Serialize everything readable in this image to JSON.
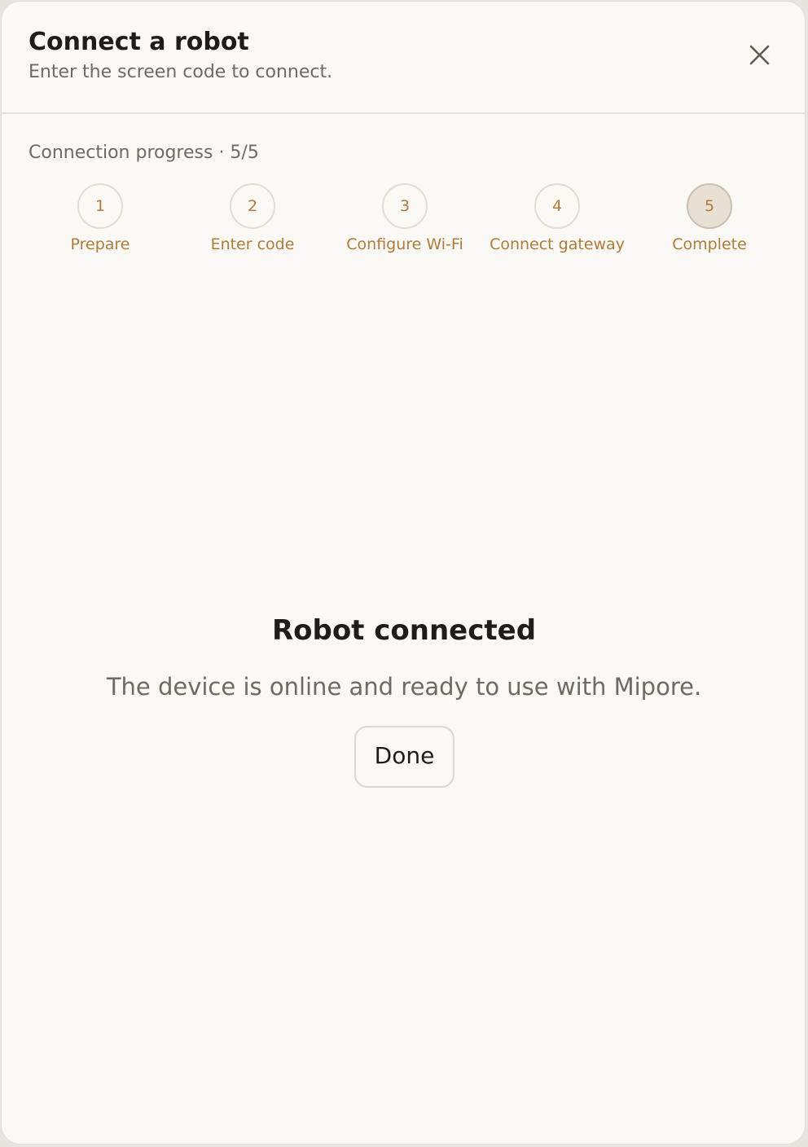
{
  "dialog": {
    "title": "Connect a robot",
    "subtitle": "Enter the screen code to connect.",
    "close_icon": "close-icon"
  },
  "progress": {
    "label": "Connection progress · 5/5",
    "current_step": 5,
    "total_steps": 5,
    "steps": [
      {
        "number": "1",
        "label": "Prepare"
      },
      {
        "number": "2",
        "label": "Enter code"
      },
      {
        "number": "3",
        "label": "Configure Wi-Fi"
      },
      {
        "number": "4",
        "label": "Connect gateway"
      },
      {
        "number": "5",
        "label": "Complete"
      }
    ]
  },
  "result": {
    "title": "Robot connected",
    "message": "The device is online and ready to use with Mipore.",
    "done_label": "Done"
  },
  "colors": {
    "background": "#faf9f5",
    "accent": "#b07b3a",
    "title_text": "#1f1d1a",
    "muted_text": "#6f6a62",
    "active_step_fill": "#e8e0d5"
  }
}
